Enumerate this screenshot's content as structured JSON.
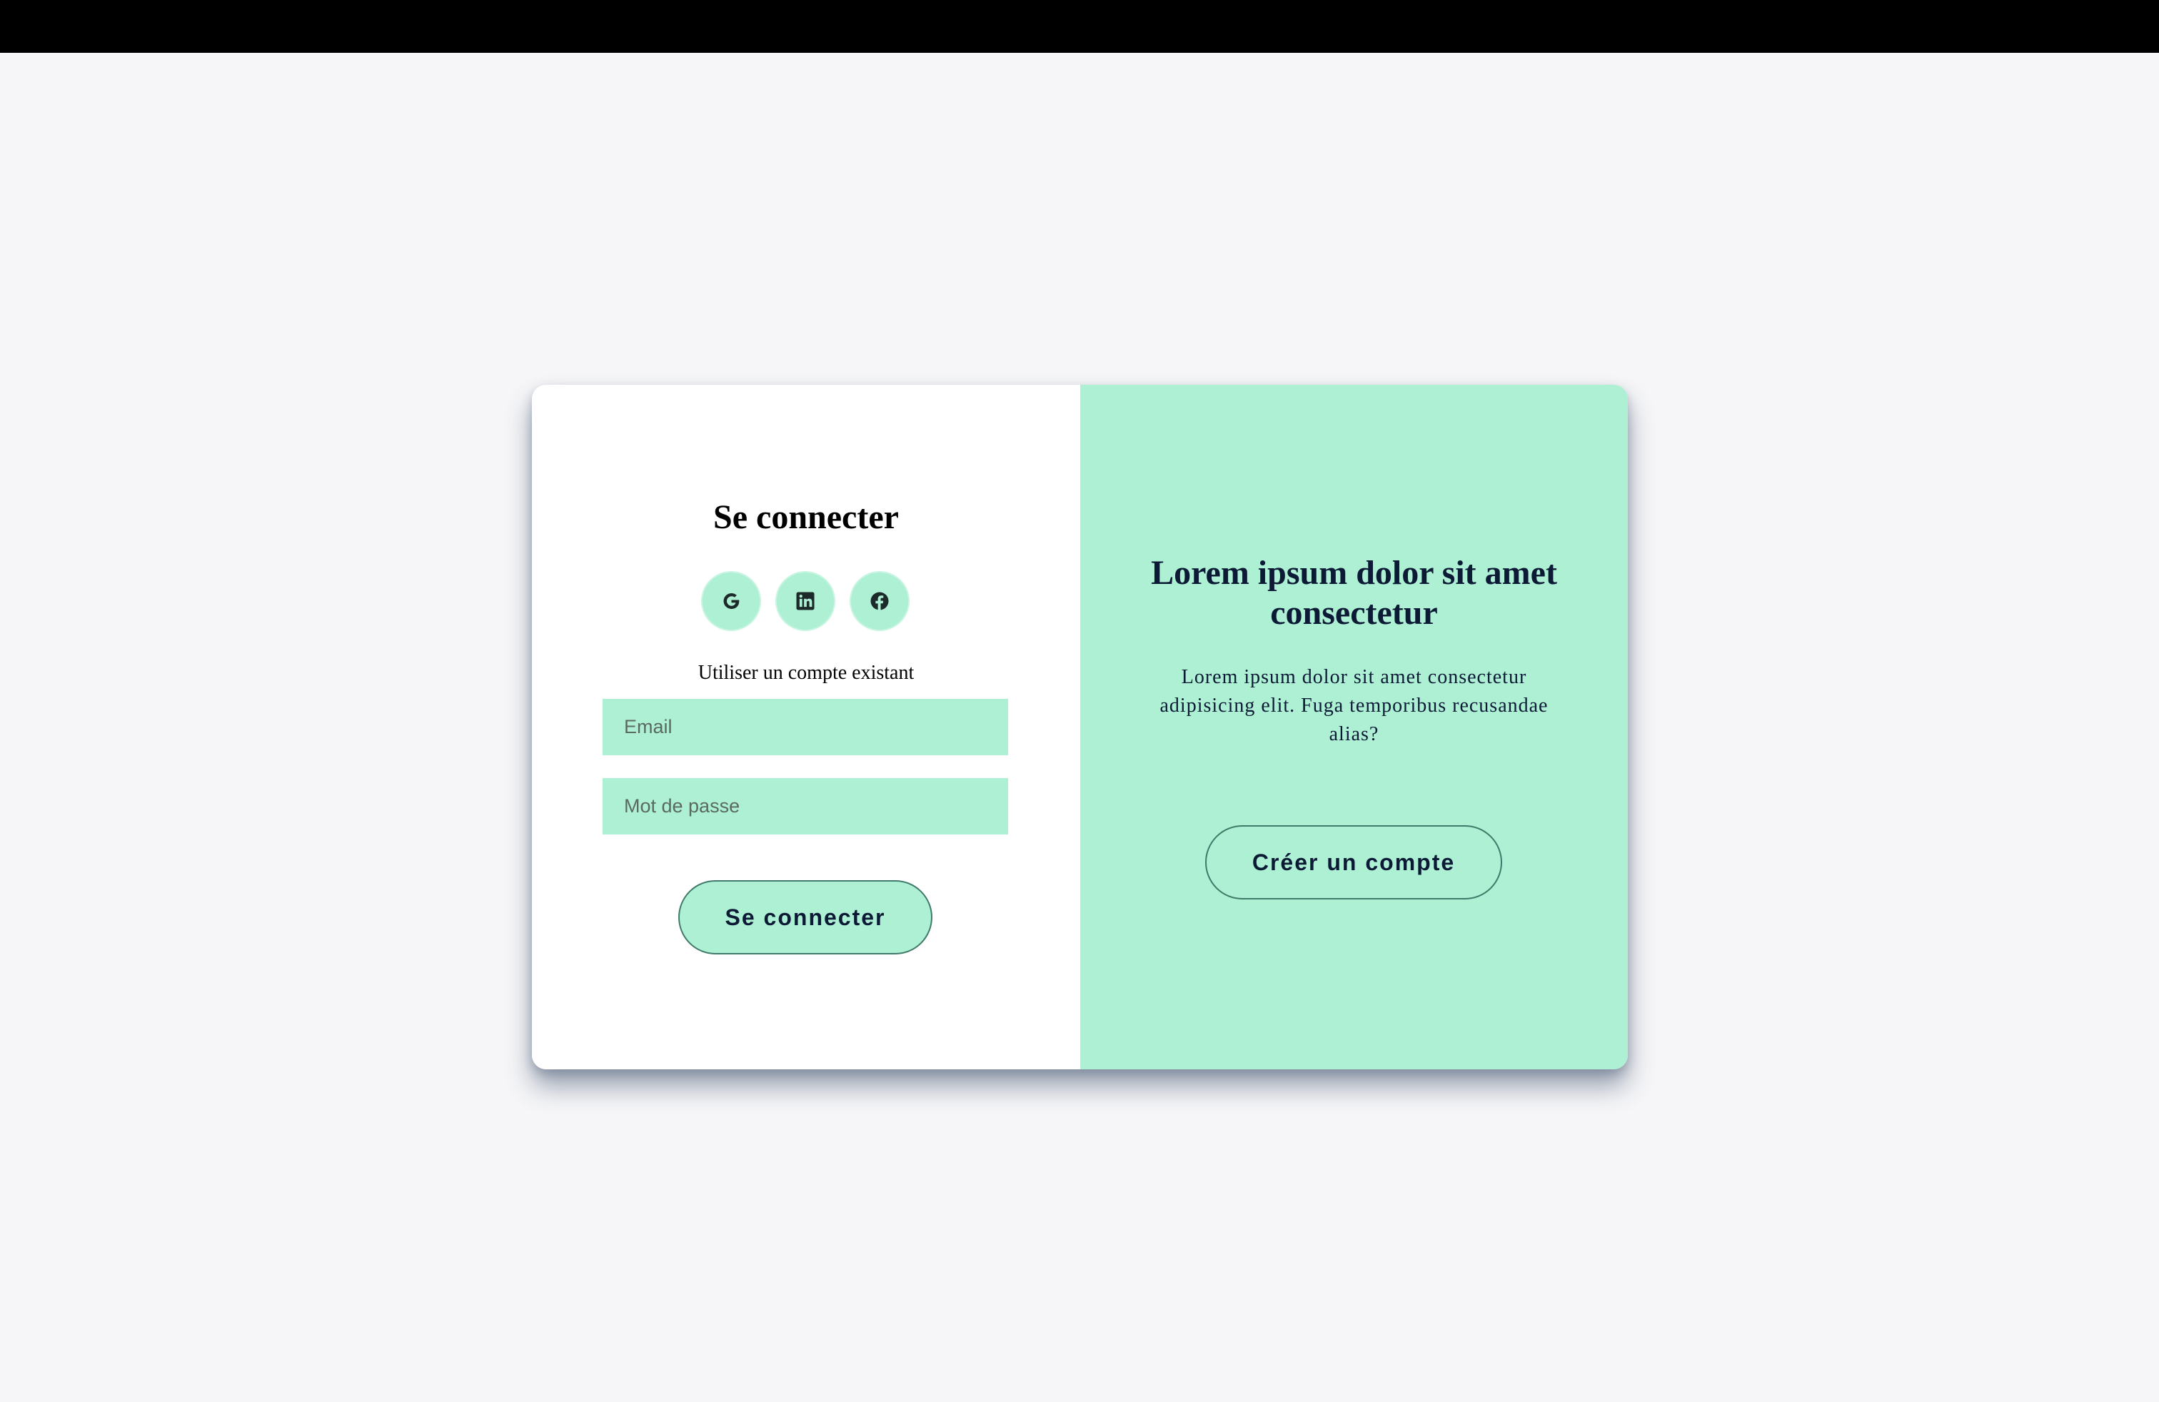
{
  "login": {
    "title": "Se connecter",
    "social": [
      {
        "icon": "google-icon"
      },
      {
        "icon": "linkedin-icon"
      },
      {
        "icon": "facebook-icon"
      }
    ],
    "existing_label": "Utiliser un compte existant",
    "email_placeholder": "Email",
    "password_placeholder": "Mot de passe",
    "submit_label": "Se connecter"
  },
  "promo": {
    "title": "Lorem ipsum dolor sit amet consectetur",
    "text": "Lorem ipsum dolor sit amet consectetur adipisicing elit. Fuga temporibus recusandae alias?",
    "create_label": "Créer un compte"
  },
  "colors": {
    "accent": "#aef0d3",
    "dark_text": "#0c1a36",
    "page_bg": "#f6f6f8",
    "button_border": "#3f7a6a"
  }
}
